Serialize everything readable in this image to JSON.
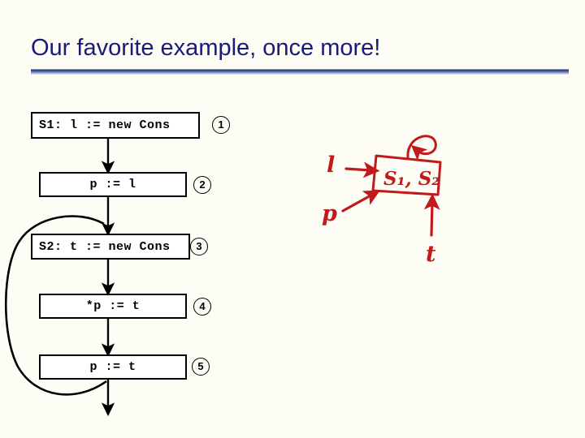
{
  "slide": {
    "title": "Our favorite example, once more!",
    "background_color": "#fdfdf5",
    "title_color": "#1a1a7a",
    "rule_color": "#2a3470"
  },
  "flowchart": {
    "type": "control-flow-graph",
    "line_color": "#000000",
    "nodes": [
      {
        "id": "1",
        "label": "S1: l := new Cons",
        "marker": "1",
        "align": "left"
      },
      {
        "id": "2",
        "label": "p := l",
        "marker": "2",
        "align": "center"
      },
      {
        "id": "3",
        "label": "S2: t := new Cons",
        "marker": "3",
        "align": "left"
      },
      {
        "id": "4",
        "label": "*p := t",
        "marker": "4",
        "align": "center"
      },
      {
        "id": "5",
        "label": "p := t",
        "marker": "5",
        "align": "center"
      }
    ],
    "edges": [
      {
        "from": "1",
        "to": "2",
        "kind": "straight"
      },
      {
        "from": "2",
        "to": "3",
        "kind": "straight"
      },
      {
        "from": "3",
        "to": "4",
        "kind": "straight"
      },
      {
        "from": "4",
        "to": "5",
        "kind": "straight"
      },
      {
        "from": "5",
        "to": "3",
        "kind": "back-edge-loop"
      },
      {
        "from": "5",
        "to": "exit",
        "kind": "exit"
      }
    ]
  },
  "annotation": {
    "color": "#c01a1a",
    "style": "handwritten",
    "heap_cell_label": "S₁, S₂",
    "pointer_l": "l",
    "pointer_p": "p",
    "pointer_t": "t",
    "self_loop": "self-edge on heap cell"
  }
}
